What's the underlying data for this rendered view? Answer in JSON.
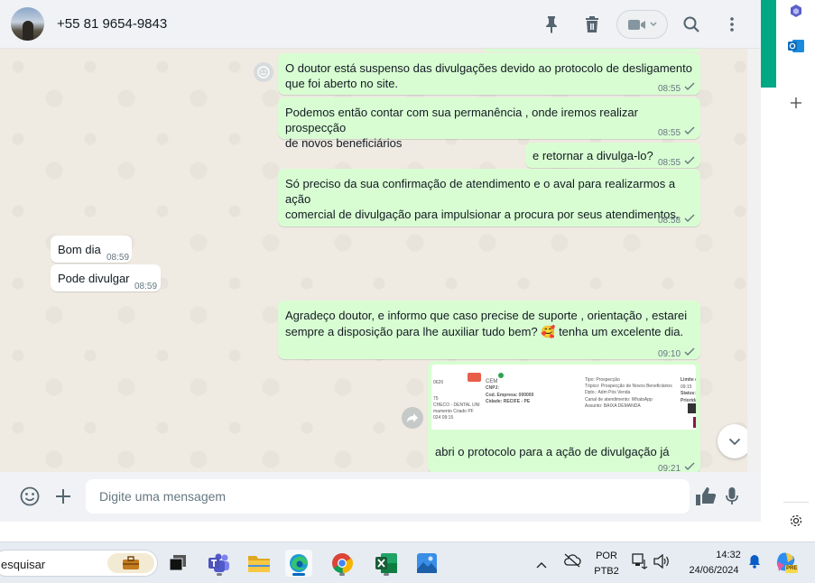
{
  "header": {
    "contact_name": "+55 81 9654-9843",
    "icons": [
      "pin-icon",
      "trash-icon",
      "video-call-icon",
      "search-icon",
      "more-options-icon"
    ]
  },
  "messages": [
    {
      "direction": "out",
      "text": "O doutor está suspenso das divulgações devido ao protocolo de desligamento\nque foi aberto no site.",
      "time": "08:55",
      "status": "read"
    },
    {
      "direction": "out",
      "text": "Podemos então contar com sua permanência , onde iremos realizar prospecção\nde novos beneficiários",
      "time": "08:55",
      "status": "read"
    },
    {
      "direction": "out",
      "text": "e retornar a divulga-lo?",
      "time": "08:55",
      "status": "read"
    },
    {
      "direction": "out",
      "text": "Só preciso da sua confirmação de atendimento e o aval para realizarmos a ação\ncomercial de divulgação para impulsionar a procura por seus atendimentos.",
      "time": "08:58",
      "status": "read"
    },
    {
      "direction": "in",
      "text": "Bom dia",
      "time": "08:59"
    },
    {
      "direction": "in",
      "text": "Pode divulgar",
      "time": "08:59"
    },
    {
      "direction": "out",
      "text": "Agradeço doutor, e informo que caso precise de suporte , orientação , estarei\nsempre a disposição para lhe auxiliar tudo bem? 🥰 tenha um excelente dia.",
      "time": "09:10",
      "status": "read"
    },
    {
      "direction": "out",
      "text": "abri o protocolo para a ação de divulgação já",
      "time": "09:21",
      "status": "read",
      "has_image": true
    }
  ],
  "image_card": {
    "left_col": [
      "0626",
      "75",
      "CHECO - DENTAL UNI",
      "mamento Criado PF",
      "024 09:15"
    ],
    "mid_col": [
      "CEM",
      "CNPJ:",
      "Cod. Empresa: 000000",
      "Cidade: RECIFE - PE"
    ],
    "right_col": [
      "Tipo: Prospecção",
      "Tópico: Prospecção de Novos Beneficiários",
      "Dpto.: Adm Pós Venda",
      "Canal de atendimento: WhatsApp",
      "Assunto: BAIXA DEMANDA"
    ],
    "far_col": [
      "Limite d",
      "09:15",
      "Status:",
      "Priorida"
    ]
  },
  "composer": {
    "placeholder": "Digite uma mensagem"
  },
  "taskbar": {
    "search_label": "esquisar",
    "apps": [
      "briefcase-app",
      "task-view",
      "teams-app",
      "file-explorer",
      "edge-browser",
      "chrome-browser",
      "excel-app",
      "photos-app"
    ],
    "tray": {
      "lang_top": "POR",
      "lang_bottom": "PTB2",
      "time": "14:32",
      "date": "24/06/2024"
    }
  },
  "colors": {
    "outgoing_bubble": "#d9fdd3",
    "incoming_bubble": "#ffffff",
    "chat_bg": "#efeae2",
    "header_bg": "#f0f2f5",
    "accent_green": "#00a884",
    "read_tick": "#667781"
  }
}
